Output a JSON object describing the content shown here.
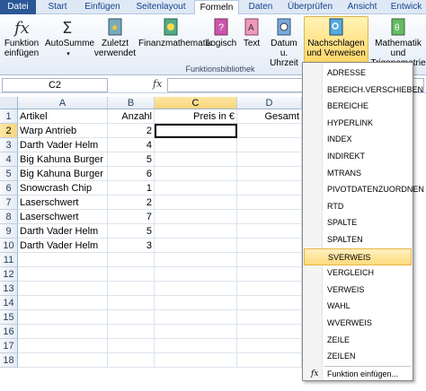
{
  "ribbon_tabs": [
    "Datei",
    "Start",
    "Einfügen",
    "Seitenlayout",
    "Formeln",
    "Daten",
    "Überprüfen",
    "Ansicht",
    "Entwick"
  ],
  "ribbon": {
    "insert_function": "Funktion einfügen",
    "autosum": "AutoSumme",
    "recently_used": "Zuletzt verwendet",
    "financial": "Finanzmathematik",
    "logical": "Logisch",
    "text": "Text",
    "datetime": "Datum u. Uhrzeit",
    "lookup": "Nachschlagen und Verweisen",
    "math": "Mathematik und Trigonometrie",
    "group_label": "Funktionsbibliothek"
  },
  "formula_bar": {
    "name_box": "C2",
    "fx": "fx",
    "formula": ""
  },
  "columns": [
    "A",
    "B",
    "C",
    "D"
  ],
  "rows": [
    "1",
    "2",
    "3",
    "4",
    "5",
    "6",
    "7",
    "8",
    "9",
    "10",
    "11",
    "12",
    "13",
    "14",
    "15",
    "16",
    "17",
    "18"
  ],
  "table": {
    "headers": [
      "Artikel",
      "Anzahl",
      "Preis in €",
      "Gesamt"
    ],
    "data": [
      [
        "Warp Antrieb",
        "2"
      ],
      [
        "Darth Vader Helm",
        "4"
      ],
      [
        "Big Kahuna Burger",
        "5"
      ],
      [
        "Big Kahuna Burger",
        "6"
      ],
      [
        "Snowcrash Chip",
        "1"
      ],
      [
        "Laserschwert",
        "2"
      ],
      [
        "Laserschwert",
        "7"
      ],
      [
        "Darth Vader Helm",
        "5"
      ],
      [
        "Darth Vader Helm",
        "3"
      ]
    ]
  },
  "dropdown": {
    "items": [
      "ADRESSE",
      "BEREICH.VERSCHIEBEN",
      "BEREICHE",
      "HYPERLINK",
      "INDEX",
      "INDIREKT",
      "MTRANS",
      "PIVOTDATENZUORDNEN",
      "RTD",
      "SPALTE",
      "SPALTEN",
      "SVERWEIS",
      "VERGLEICH",
      "VERWEIS",
      "WAHL",
      "WVERWEIS",
      "ZEILE",
      "ZEILEN"
    ],
    "highlighted": "SVERWEIS",
    "footer": "Funktion einfügen..."
  }
}
